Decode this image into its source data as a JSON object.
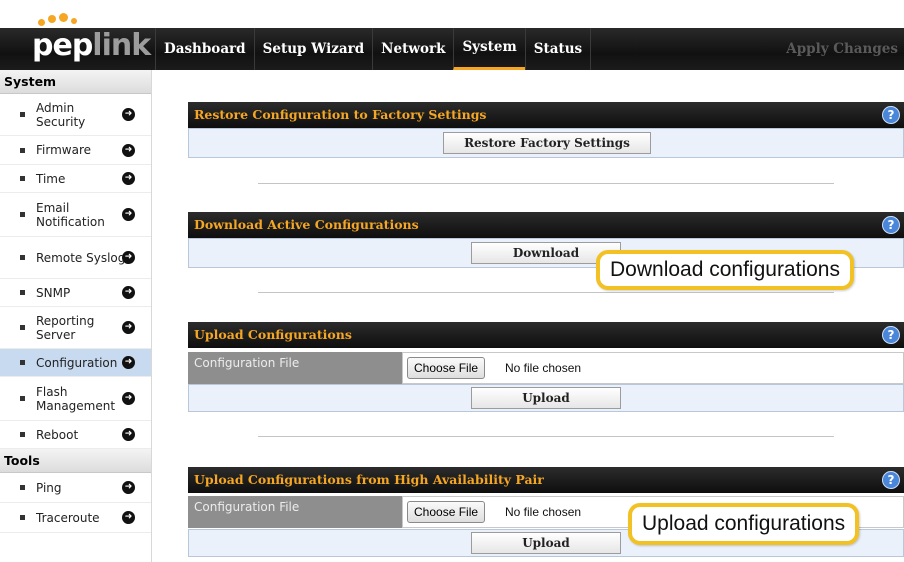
{
  "logo": {
    "text_a": "pep",
    "text_b": "link"
  },
  "nav": {
    "items": [
      "Dashboard",
      "Setup Wizard",
      "Network",
      "System",
      "Status"
    ],
    "active": "System",
    "apply": "Apply Changes"
  },
  "sidebar": {
    "system_head": "System",
    "items": [
      {
        "label": "Admin Security"
      },
      {
        "label": "Firmware"
      },
      {
        "label": "Time"
      },
      {
        "label": "Email Notification"
      },
      {
        "label": "Remote Syslog"
      },
      {
        "label": "SNMP"
      },
      {
        "label": "Reporting Server"
      },
      {
        "label": "Configuration"
      },
      {
        "label": "Flash Management"
      },
      {
        "label": "Reboot"
      }
    ],
    "tools_head": "Tools",
    "tools": [
      {
        "label": "Ping"
      },
      {
        "label": "Traceroute"
      }
    ]
  },
  "panels": {
    "restore": {
      "title": "Restore Configuration to Factory Settings",
      "button": "Restore Factory Settings"
    },
    "download": {
      "title": "Download Active Configurations",
      "button": "Download"
    },
    "upload": {
      "title": "Upload Configurations",
      "field_label": "Configuration File",
      "choose": "Choose File",
      "nofile": "No file chosen",
      "button": "Upload"
    },
    "upload_ha": {
      "title": "Upload Configurations from High Availability Pair",
      "field_label": "Configuration File",
      "choose": "Choose File",
      "nofile": "No file chosen",
      "button": "Upload"
    }
  },
  "help_glyph": "?",
  "callouts": {
    "download": "Download configurations",
    "upload": "Upload configurations"
  },
  "colors": {
    "accent": "#f5a623",
    "nav_bg": "#111111",
    "row_bg": "#eaf1fb",
    "active_side": "#c8daf0",
    "callout_border": "#f2c224"
  }
}
